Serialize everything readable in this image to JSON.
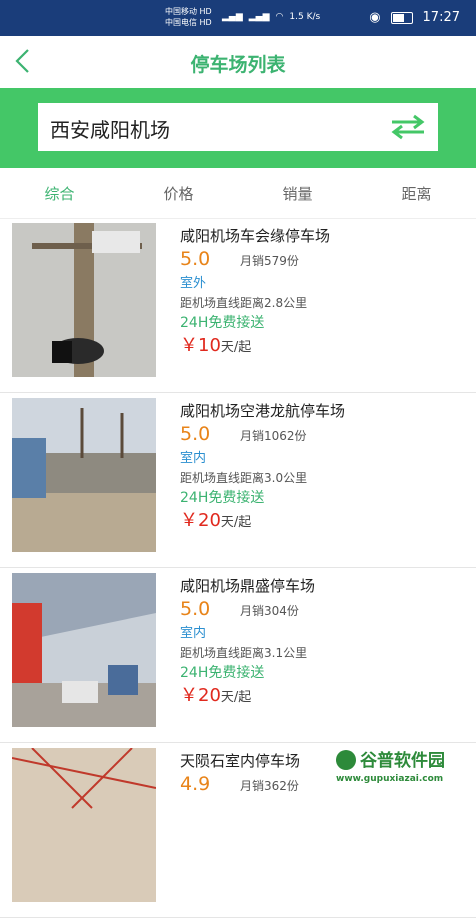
{
  "status_bar": {
    "carrier_1": "中国移动 HD",
    "carrier_2": "中国电信 HD",
    "net_speed": "1.5 K/s",
    "time": "17:27"
  },
  "header": {
    "title": "停车场列表",
    "back_icon": "chevron-left-icon"
  },
  "search": {
    "value": "西安咸阳机场",
    "swap_icon": "swap-arrows-icon"
  },
  "tabs": [
    {
      "label": "综合",
      "active": true
    },
    {
      "label": "价格",
      "active": false
    },
    {
      "label": "销量",
      "active": false
    },
    {
      "label": "距离",
      "active": false
    }
  ],
  "lots": [
    {
      "name": "咸阳机场车会缘停车场",
      "score": "5.0",
      "sales": "月销579份",
      "type": "室外",
      "distance": "距机场直线距离2.8公里",
      "shuttle": "24H免费接送",
      "price_symbol": "￥",
      "price": "10",
      "price_unit": "天/起"
    },
    {
      "name": "咸阳机场空港龙航停车场",
      "score": "5.0",
      "sales": "月销1062份",
      "type": "室内",
      "distance": "距机场直线距离3.0公里",
      "shuttle": "24H免费接送",
      "price_symbol": "￥",
      "price": "20",
      "price_unit": "天/起"
    },
    {
      "name": "咸阳机场鼎盛停车场",
      "score": "5.0",
      "sales": "月销304份",
      "type": "室内",
      "distance": "距机场直线距离3.1公里",
      "shuttle": "24H免费接送",
      "price_symbol": "￥",
      "price": "20",
      "price_unit": "天/起"
    },
    {
      "name": "天陨石室内停车场",
      "score": "4.9",
      "sales": "月销362份"
    }
  ],
  "watermark": {
    "text": "谷普软件园",
    "url": "www.gupuxiazai.com"
  },
  "colors": {
    "accent": "#3cb371",
    "search_bg": "#44c767",
    "score": "#e8841a",
    "price": "#e0291e",
    "type": "#2b8fd0"
  }
}
